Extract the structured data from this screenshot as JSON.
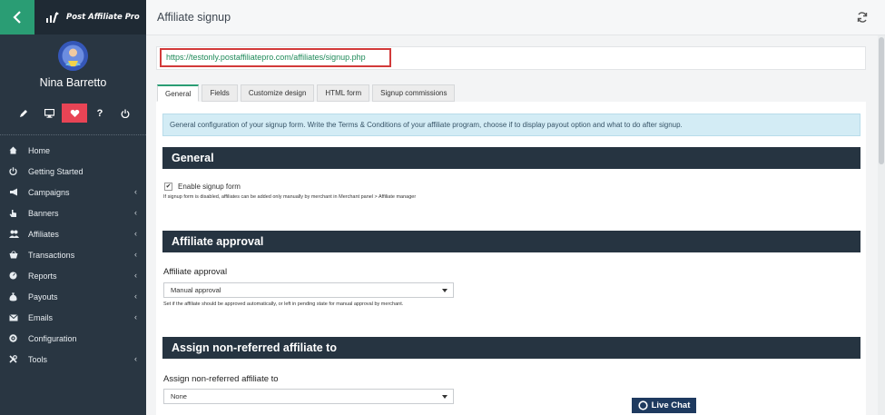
{
  "app": {
    "brand": "Post Affiliate Pro"
  },
  "user": {
    "name": "Nina Barretto"
  },
  "toolbar": {
    "help_label": "?"
  },
  "sidebar": {
    "items": [
      {
        "label": "Home",
        "icon": "home-icon",
        "has_submenu": false
      },
      {
        "label": "Getting Started",
        "icon": "power-icon",
        "has_submenu": false
      },
      {
        "label": "Campaigns",
        "icon": "megaphone-icon",
        "has_submenu": true
      },
      {
        "label": "Banners",
        "icon": "hand-icon",
        "has_submenu": true
      },
      {
        "label": "Affiliates",
        "icon": "users-icon",
        "has_submenu": true
      },
      {
        "label": "Transactions",
        "icon": "basket-icon",
        "has_submenu": true
      },
      {
        "label": "Reports",
        "icon": "gauge-icon",
        "has_submenu": true
      },
      {
        "label": "Payouts",
        "icon": "moneybag-icon",
        "has_submenu": true
      },
      {
        "label": "Emails",
        "icon": "envelope-icon",
        "has_submenu": true
      },
      {
        "label": "Configuration",
        "icon": "gear-icon",
        "has_submenu": false
      },
      {
        "label": "Tools",
        "icon": "wrench-icon",
        "has_submenu": true
      }
    ]
  },
  "page": {
    "title": "Affiliate signup",
    "signup_url": "https://testonly.postaffiliatepro.com/affiliates/signup.php"
  },
  "tabs": [
    {
      "label": "General",
      "active": true
    },
    {
      "label": "Fields",
      "active": false
    },
    {
      "label": "Customize design",
      "active": false
    },
    {
      "label": "HTML form",
      "active": false
    },
    {
      "label": "Signup commissions",
      "active": false
    }
  ],
  "general": {
    "info": "General configuration of your signup form. Write the Terms & Conditions of your affiliate program, choose if to display payout option and what to do after signup.",
    "section_title": "General",
    "enable_label": "Enable signup form",
    "enable_checked": true,
    "enable_help": "If signup form is disabled, affiliates can be added only manually by merchant in Merchant panel > Affiliate manager"
  },
  "approval": {
    "section_title": "Affiliate approval",
    "field_label": "Affiliate approval",
    "value": "Manual approval",
    "help": "Set if the affiliate should be approved automatically, or left in pending state for manual approval by merchant."
  },
  "assign": {
    "section_title": "Assign non-referred affiliate to",
    "field_label": "Assign non-referred affiliate to",
    "value": "None"
  },
  "livechat": {
    "label": "Live Chat"
  },
  "colors": {
    "sidebar_bg": "#293642",
    "accent_green": "#2a9d74",
    "active_tool_red": "#e84455",
    "section_header_bg": "#263441",
    "url_highlight_border": "#d23a3a",
    "info_bg": "#d3ecf5"
  }
}
